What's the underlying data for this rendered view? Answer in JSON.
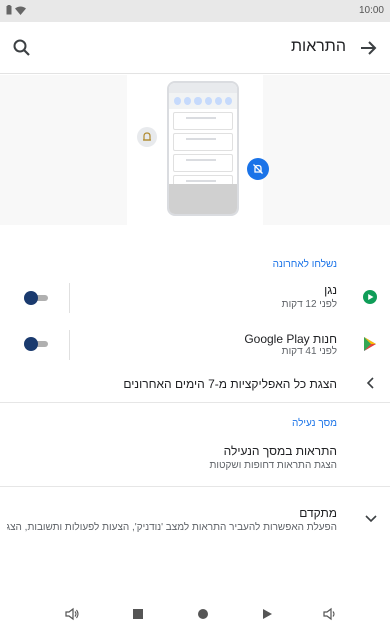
{
  "status_bar": {
    "time": "10:00"
  },
  "app_bar": {
    "title": "התראות"
  },
  "recent": {
    "section_label": "נשלחו לאחרונה",
    "apps": [
      {
        "name": "נגן",
        "time": "לפני 12 דקות",
        "icon": "play-store-green-icon"
      },
      {
        "name": "חנות Google Play",
        "time": "לפני 41 דקות",
        "icon": "google-play-icon"
      }
    ],
    "see_all": "הצגת כל האפליקציות מ-7 הימים האחרונים"
  },
  "lock_screen": {
    "section_label": "מסך נעילה",
    "title": "התראות במסך הנעילה",
    "subtitle": "הצגת התראות דחופות ושקטות"
  },
  "advanced": {
    "title": "מתקדם",
    "subtitle": "הפעלת האפשרות להעביר התראות למצב 'נודניק', הצעות לפעולות ותשובות, הצגה ש..."
  },
  "colors": {
    "accent": "#1a73e8",
    "toggle_thumb": "#1a3a6e",
    "green": "#0f9d58"
  }
}
